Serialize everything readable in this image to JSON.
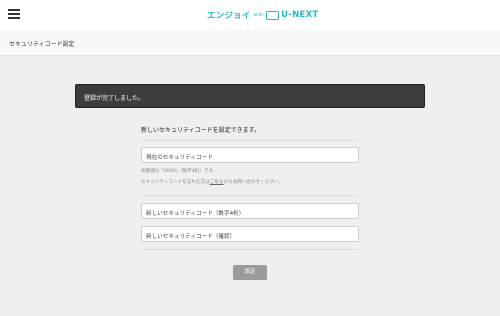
{
  "header": {
    "logo": {
      "brand_part1": "エンジョイ",
      "with": "with",
      "brand_part2": "U-NEXT"
    }
  },
  "subheader": {
    "title": "セキュリティコード設定"
  },
  "alert": {
    "message": "登録が完了しました。"
  },
  "form": {
    "intro": "新しいセキュリティコードを設定できます。",
    "current_code": {
      "placeholder": "現在のセキュリティコード",
      "value": ""
    },
    "note_default": "初期値は「0000」（数字4桁）です。",
    "note_forgot_prefix": "セキュリティコードを忘れた方は",
    "note_forgot_link": "こちら",
    "note_forgot_suffix": "からお問い合わせください。",
    "new_code": {
      "placeholder": "新しいセキュリティコード（数字4桁）",
      "value": ""
    },
    "confirm_code": {
      "placeholder": "新しいセキュリティコード（確認）",
      "value": ""
    },
    "submit_label": "設定"
  },
  "colors": {
    "brand": "#1dbcc2",
    "alert_bg": "#3d3d3d",
    "button_bg": "#9b9b9b",
    "page_bg": "#efefef"
  },
  "icons": {
    "menu": "hamburger-icon",
    "logo_mark": "tv-screen-icon"
  }
}
